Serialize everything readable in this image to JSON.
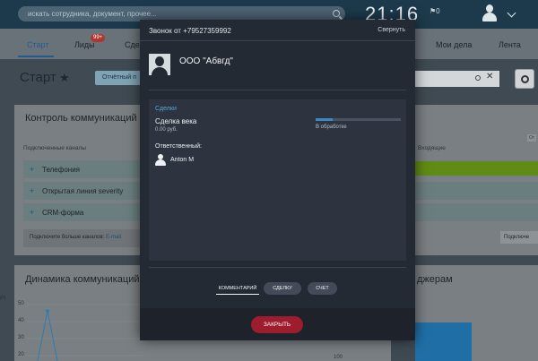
{
  "topbar": {
    "search_placeholder": "искать сотрудника, документ, прочее...",
    "time": "21:16",
    "flag_count": "0"
  },
  "nav": {
    "start": "Старт",
    "leads": "Лиды",
    "leads_badge": "99+",
    "deals_partial": "Сдел",
    "my_deals": "Мои дела",
    "feed": "Лента"
  },
  "page": {
    "title": "Старт",
    "report_button": "Отчётный п"
  },
  "panel1": {
    "title": "Контроль коммуникаций",
    "subtitle": "Подключенные каналы",
    "channels": [
      "Телефония",
      "Открытая линия severity",
      "CRM-форма"
    ],
    "more_text": "Подключите больше каналов: ",
    "more_link": "E-mail",
    "right_subtitle": "Входящие",
    "right_tag": "От",
    "right_more": "Подключе"
  },
  "panel2": {
    "title": "Динамика коммуникаций",
    "right_title": "джерам",
    "api_label": "PI",
    "axis_50": "50",
    "axis_40": "40",
    "axis_30": "30",
    "axis_20": "20",
    "axis_10": "10",
    "axis_100": "100"
  },
  "modal": {
    "call_title": "Звонок от +79527359992",
    "collapse": "Свернуть",
    "company": "ООО \"Абвгд\"",
    "deals_label": "Сделки",
    "deal_name": "Сделка века",
    "deal_sum": "0.00 руб.",
    "deal_stage": "В обработке",
    "deal_progress": 0.2,
    "responsible_label": "Ответственный:",
    "responsible_name": "Anton M",
    "tab_comment": "КОММЕНТАРИЙ",
    "tab_deal": "СДЕЛКУ",
    "tab_invoice": "СЧЕТ",
    "close_button": "ЗАКРЫТЬ"
  },
  "colors": {
    "accent_blue": "#54a7d9",
    "progress": "#3f86c6",
    "close_red": "#9d1c2d",
    "green_bar": "#5f8c14"
  }
}
